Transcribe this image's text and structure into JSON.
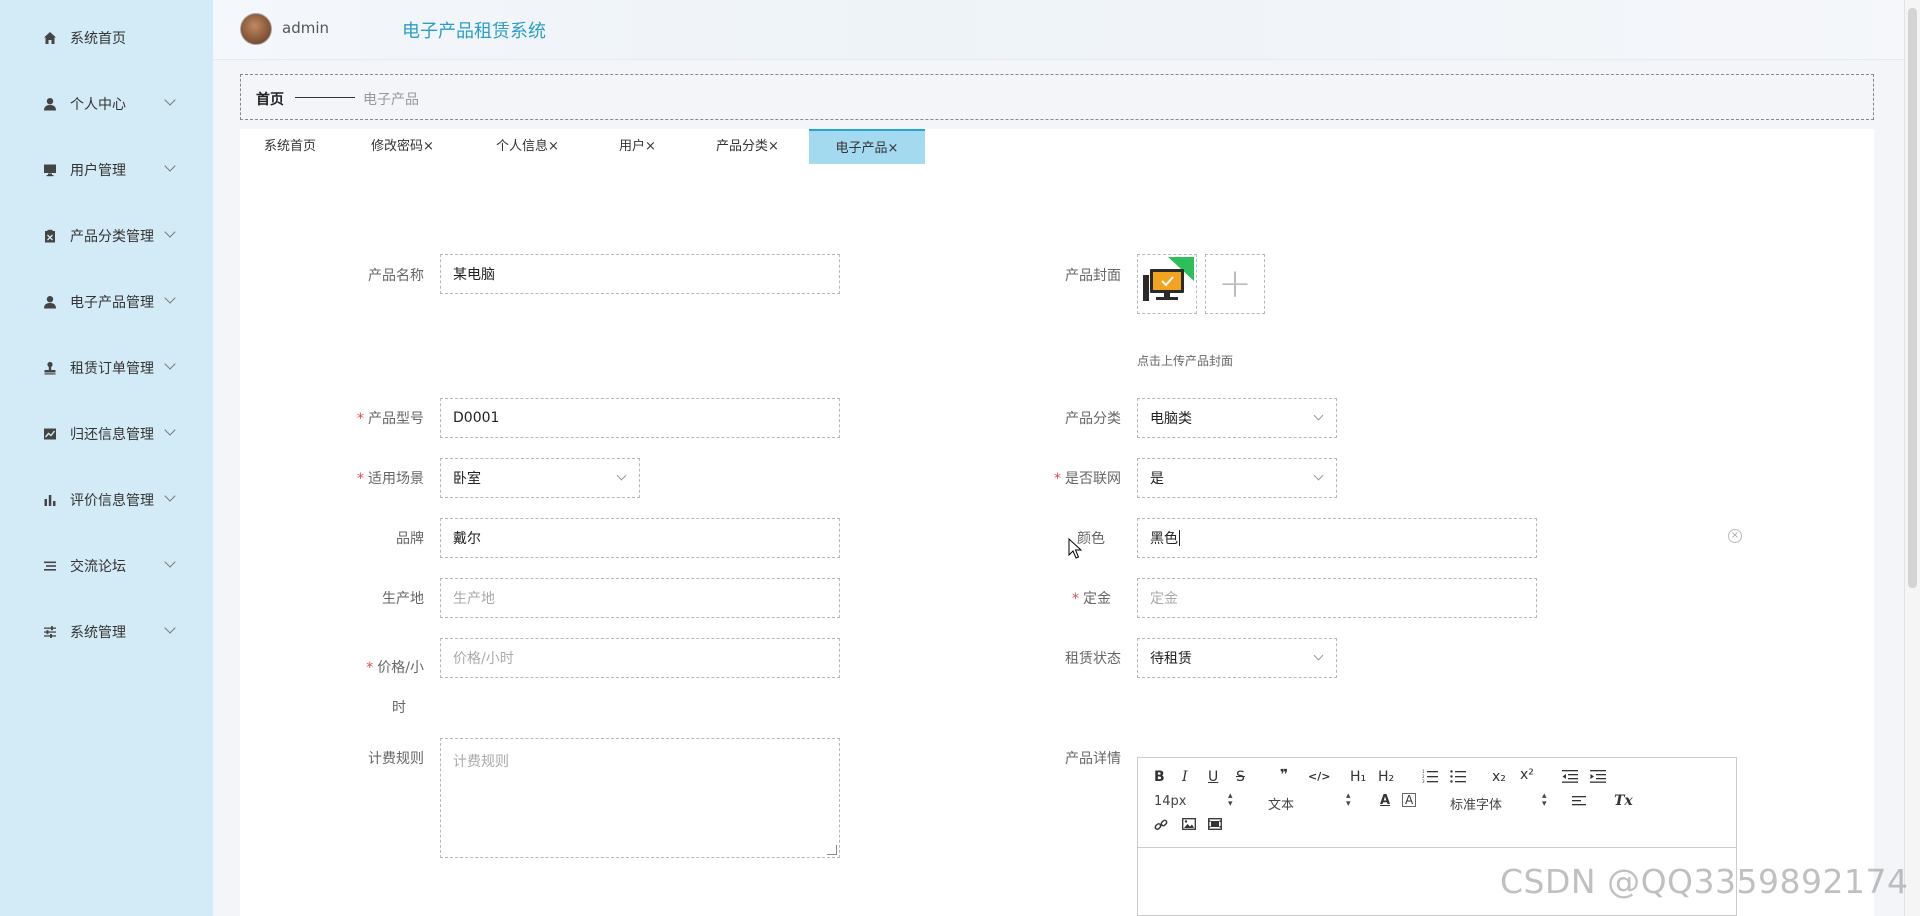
{
  "sidebar": {
    "items": [
      {
        "label": "系统首页",
        "icon": "home-icon"
      },
      {
        "label": "个人中心",
        "icon": "user-icon"
      },
      {
        "label": "用户管理",
        "icon": "monitor-icon"
      },
      {
        "label": "产品分类管理",
        "icon": "clipboard-icon"
      },
      {
        "label": "电子产品管理",
        "icon": "user-icon"
      },
      {
        "label": "租赁订单管理",
        "icon": "stamp-icon"
      },
      {
        "label": "归还信息管理",
        "icon": "chart-line-icon"
      },
      {
        "label": "评价信息管理",
        "icon": "bar-chart-icon"
      },
      {
        "label": "交流论坛",
        "icon": "list-icon"
      },
      {
        "label": "系统管理",
        "icon": "sliders-icon"
      }
    ]
  },
  "header": {
    "username": "admin",
    "app_title": "电子产品租赁系统"
  },
  "breadcrumb": {
    "home": "首页",
    "current": "电子产品"
  },
  "tabs": [
    {
      "label": "系统首页",
      "closable": false
    },
    {
      "label": "修改密码",
      "closable": true
    },
    {
      "label": "个人信息",
      "closable": true
    },
    {
      "label": "用户",
      "closable": true
    },
    {
      "label": "产品分类",
      "closable": true
    },
    {
      "label": "电子产品",
      "closable": true,
      "active": true
    }
  ],
  "tab_close_glyph": "×",
  "form": {
    "required_mark": "*",
    "product_name": {
      "label": "产品名称",
      "value": "某电脑"
    },
    "product_cover": {
      "label": "产品封面",
      "tip": "点击上传产品封面",
      "plus": "+"
    },
    "model": {
      "label": "产品型号",
      "value": "D0001"
    },
    "category": {
      "label": "产品分类",
      "value": "电脑类"
    },
    "scene": {
      "label": "适用场景",
      "value": "卧室"
    },
    "networked": {
      "label": "是否联网",
      "value": "是"
    },
    "brand": {
      "label": "品牌",
      "value": "戴尔"
    },
    "color": {
      "label": "颜色",
      "value": "黑色"
    },
    "origin": {
      "label": "生产地",
      "placeholder": "生产地"
    },
    "deposit": {
      "label": "定金",
      "placeholder": "定金"
    },
    "price": {
      "label_line1": "价格/小",
      "label_line2": "时",
      "placeholder": "价格/小时"
    },
    "rent_status": {
      "label": "租赁状态",
      "value": "待租赁"
    },
    "billing_rule": {
      "label": "计费规则",
      "placeholder": "计费规则"
    },
    "detail": {
      "label": "产品详情"
    }
  },
  "editor": {
    "font_size": "14px",
    "block_type": "文本",
    "font_family": "标准字体",
    "bold": "B",
    "italic": "I",
    "underline": "U",
    "strike": "S",
    "quote": "❞",
    "code": "</>",
    "h1": "H₁",
    "h2": "H₂",
    "sub": "x₂",
    "sup": "x²",
    "clear_format": "Tx",
    "color": "A",
    "bg_color": "A"
  },
  "watermark": "CSDN @QQ3359892174",
  "colors": {
    "sidebar_bg": "#d3ebf7",
    "accent": "#2a9fc9",
    "active_tab": "#a4daf0",
    "required": "#e24a4a"
  }
}
